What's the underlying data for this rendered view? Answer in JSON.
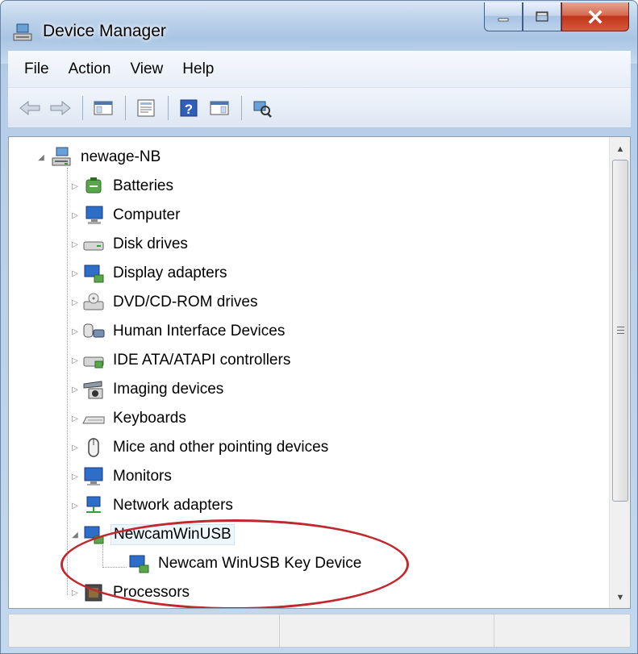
{
  "window": {
    "title": "Device Manager"
  },
  "menubar": {
    "items": [
      "File",
      "Action",
      "View",
      "Help"
    ]
  },
  "toolbar": {
    "buttons": [
      {
        "icon": "back-arrow-icon"
      },
      {
        "icon": "forward-arrow-icon"
      },
      {
        "icon": "show-hide-console-tree-icon"
      },
      {
        "icon": "properties-icon"
      },
      {
        "icon": "help-icon"
      },
      {
        "icon": "action-pane-icon"
      },
      {
        "icon": "scan-hardware-icon"
      }
    ]
  },
  "tree": {
    "root": {
      "label": "newage-NB",
      "icon": "computer-network-icon",
      "expanded": true
    },
    "categories": [
      {
        "label": "Batteries",
        "icon": "battery-icon"
      },
      {
        "label": "Computer",
        "icon": "computer-icon"
      },
      {
        "label": "Disk drives",
        "icon": "disk-drive-icon"
      },
      {
        "label": "Display adapters",
        "icon": "display-adapter-icon"
      },
      {
        "label": "DVD/CD-ROM drives",
        "icon": "dvd-drive-icon"
      },
      {
        "label": "Human Interface Devices",
        "icon": "hid-icon"
      },
      {
        "label": "IDE ATA/ATAPI controllers",
        "icon": "ide-controller-icon"
      },
      {
        "label": "Imaging devices",
        "icon": "camera-icon"
      },
      {
        "label": "Keyboards",
        "icon": "keyboard-icon"
      },
      {
        "label": "Mice and other pointing devices",
        "icon": "mouse-icon"
      },
      {
        "label": "Monitors",
        "icon": "monitor-icon"
      },
      {
        "label": "Network adapters",
        "icon": "network-adapter-icon"
      },
      {
        "label": "NewcamWinUSB",
        "icon": "usb-device-icon",
        "expanded": true,
        "children": [
          {
            "label": "Newcam WinUSB Key Device",
            "icon": "usb-device-icon"
          }
        ]
      },
      {
        "label": "Processors",
        "icon": "processor-icon"
      }
    ]
  },
  "colors": {
    "annotation_ellipse": "#c0282e",
    "close_button": "#c1351a"
  }
}
